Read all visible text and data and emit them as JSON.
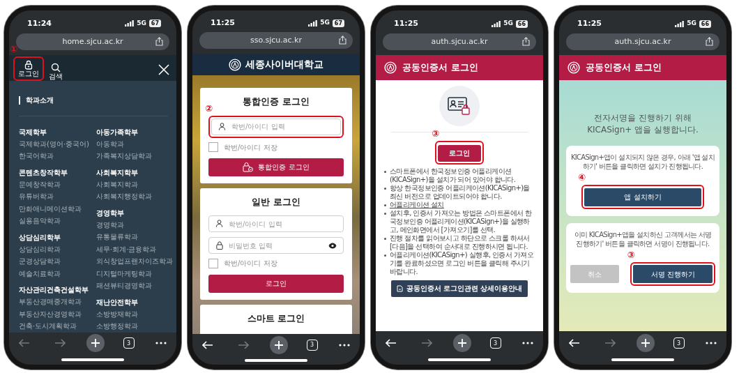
{
  "phones": [
    {
      "time": "11:24",
      "network": "5G",
      "battery": "67",
      "url": "home.sjcu.ac.kr",
      "back_disabled": true,
      "forward_disabled": true,
      "tab_count": "3",
      "screen": {
        "kind": "menu",
        "login": {
          "label": "로그인",
          "step": "①"
        },
        "search": "검색",
        "section": "학과소개",
        "columns": [
          [
            {
              "title": "국제학부",
              "items": [
                "국제학과(영어·중국어)",
                "한국어학과"
              ]
            },
            {
              "title": "콘텐츠창작학부",
              "items": [
                "문예창작학과",
                "유튜버학과",
                "만화애니메이션학과",
                "실용음악학과"
              ]
            },
            {
              "title": "상담심리학부",
              "items": [
                "상담심리학과",
                "군경상담학과",
                "예술치료학과"
              ]
            },
            {
              "title": "자산관리건축건설학부",
              "items": [
                "부동산경매중개학과",
                "부동산자산경영학과",
                "건축·도시계획학과"
              ]
            }
          ],
          [
            {
              "title": "아동가족학부",
              "items": [
                "아동학과",
                "가족복지상담학과"
              ]
            },
            {
              "title": "사회복지학부",
              "items": [
                "사회복지학과",
                "사회복지행정학과"
              ]
            },
            {
              "title": "경영학부",
              "items": [
                "경영학과",
                "유통물류학과",
                "세무·회계·금융학과",
                "외식창업프랜차이즈학과",
                "디지털마케팅학과",
                "패션뷰티경영학과"
              ]
            },
            {
              "title": "재난안전학부",
              "items": [
                "소방방재학과",
                "소방행정학과"
              ]
            }
          ]
        ]
      }
    },
    {
      "time": "11:25",
      "network": "5G",
      "battery": "67",
      "url": "sso.sjcu.ac.kr",
      "back_disabled": false,
      "forward_disabled": true,
      "tab_count": "3",
      "screen": {
        "kind": "sso",
        "brand": "세종사이버대학교",
        "integrated": {
          "title": "통합인증 로그인",
          "id_placeholder": "학번/아이디 입력",
          "step": "②",
          "save_label": "학번/아이디 저장",
          "save_checked": false,
          "button": "통합인증 로그인"
        },
        "general": {
          "title": "일반 로그인",
          "id_placeholder": "학번/아이디 입력",
          "pw_placeholder": "비밀번호 입력",
          "save_label": "학번/아이디 저장",
          "save_checked": false,
          "button": "로그인"
        },
        "smart": {
          "title": "스마트 로그인"
        }
      }
    },
    {
      "time": "11:25",
      "network": "5G",
      "battery": "66",
      "url": "auth.sjcu.ac.kr",
      "back_disabled": false,
      "forward_disabled": true,
      "tab_count": "3",
      "screen": {
        "kind": "cert",
        "header": "공동인증서 로그인",
        "login": {
          "label": "로그인",
          "step": "③"
        },
        "notes": [
          {
            "kind": "text",
            "text": "스마트폰에서 한국정보인증 어플리케이션(KICASign+)을 설치가 되어 있어야 합니다."
          },
          {
            "kind": "text",
            "text": "항상 한국정보인증 어플리케이션(KICASign+)을 최신 버전으로 업데이트되어야 합니다."
          },
          {
            "kind": "link",
            "text": "어플리케이션 설치"
          },
          {
            "kind": "text",
            "text": "설치후, 인증서 가져오는 방법은 스마트폰에서 한국정보인증 어플리케이션(KICASign+)을 실행하고, 메인화면에서 [가져오기]를 선택."
          },
          {
            "kind": "text",
            "text": "진행 절차를 읽어보시고 하단으로 스크롤 하셔서 [다음]을 선택하여 순서대로 진행하시면 됩니다."
          },
          {
            "kind": "text",
            "text": "어플리케이션(KICASign+) 실행후, 인증서 가져오기를 완료하셨으면 로그인 버튼을 클릭해 주시기 바랍니다."
          }
        ],
        "guide_button": "공동인증서 로그인관련 상세이용안내"
      }
    },
    {
      "time": "11:25",
      "network": "5G",
      "battery": "66",
      "url": "auth.sjcu.ac.kr",
      "back_disabled": false,
      "forward_disabled": true,
      "tab_count": "3",
      "screen": {
        "kind": "sign",
        "header": "공동인증서 로그인",
        "message": "전자서명을 진행하기 위해\nKICASign+ 앱을 실행합니다.",
        "install_text": "KICASign+앱이 설치되지 않은 경우, 아래 '앱 설치하기' 버튼을 클릭하면 설치가 진행됩니다.",
        "install_button": {
          "label": "앱 설치하기",
          "step": "④"
        },
        "sign_text": "이미 KICASign+앱을 설치하신 고객께서는 서명 진행하기' 버튼을 클릭하면 서명이 진행됩니다.",
        "cancel_button": "취소",
        "sign_button": {
          "label": "서명 진행하기",
          "step": "③"
        }
      }
    }
  ]
}
